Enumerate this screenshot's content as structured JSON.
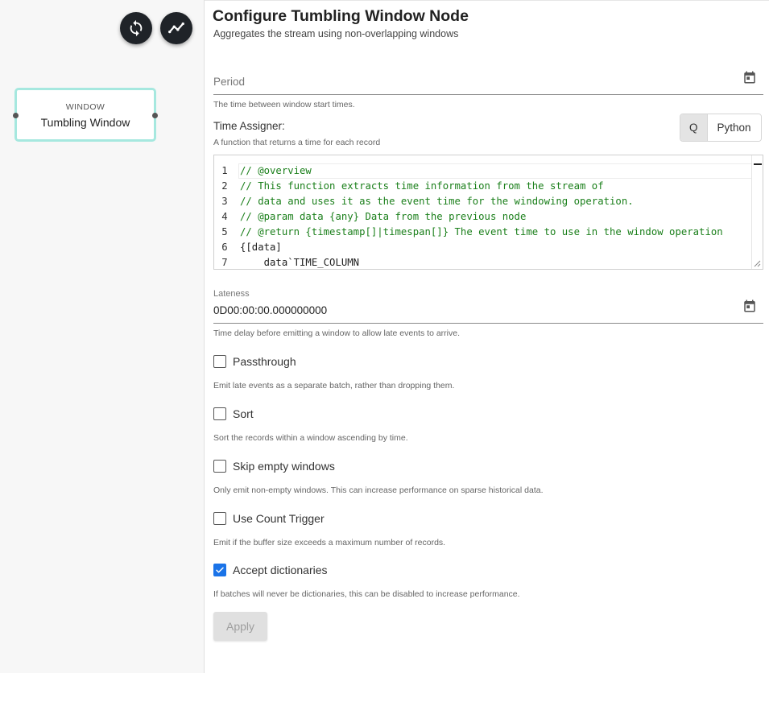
{
  "canvas": {
    "node": {
      "type": "WINDOW",
      "name": "Tumbling Window"
    }
  },
  "form": {
    "title": "Configure Tumbling Window Node",
    "subtitle": "Aggregates the stream using non-overlapping windows",
    "period": {
      "label": "Period",
      "value": "",
      "helper": "The time between window start times."
    },
    "time_assigner": {
      "label": "Time Assigner:",
      "helper": "A function that returns a time for each record",
      "languages": [
        "Q",
        "Python"
      ],
      "selected_language": "Q",
      "code_lines": [
        {
          "n": "1",
          "text": "// @overview",
          "kind": "cm"
        },
        {
          "n": "2",
          "text": "// This function extracts time information from the stream of",
          "kind": "cm"
        },
        {
          "n": "3",
          "text": "// data and uses it as the event time for the windowing operation.",
          "kind": "cm"
        },
        {
          "n": "4",
          "text": "// @param data {any} Data from the previous node",
          "kind": "cm"
        },
        {
          "n": "5",
          "text": "// @return {timestamp[]|timespan[]} The event time to use in the window operation",
          "kind": "cm"
        },
        {
          "n": "6",
          "text": "{[data]",
          "kind": "plain"
        },
        {
          "n": "7",
          "text": "    data`TIME_COLUMN",
          "kind": "mixed",
          "pre": "    data`",
          "post": "TIME_COLUMN"
        }
      ]
    },
    "lateness": {
      "label": "Lateness",
      "value": "0D00:00:00.000000000",
      "helper": "Time delay before emitting a window to allow late events to arrive."
    },
    "options": [
      {
        "id": "passthrough",
        "label": "Passthrough",
        "checked": false,
        "helper": "Emit late events as a separate batch, rather than dropping them."
      },
      {
        "id": "sort",
        "label": "Sort",
        "checked": false,
        "helper": "Sort the records within a window ascending by time."
      },
      {
        "id": "skip-empty-windows",
        "label": "Skip empty windows",
        "checked": false,
        "helper": "Only emit non-empty windows. This can increase performance on sparse historical data."
      },
      {
        "id": "use-count-trigger",
        "label": "Use Count Trigger",
        "checked": false,
        "helper": "Emit if the buffer size exceeds a maximum number of records."
      },
      {
        "id": "accept-dictionaries",
        "label": "Accept dictionaries",
        "checked": true,
        "helper": "If batches will never be dictionaries, this can be disabled to increase performance."
      }
    ],
    "apply_label": "Apply"
  },
  "colors": {
    "node_border": "#a6e8df",
    "check_accent": "#1a73e8",
    "fab_bg": "#1f2328",
    "comment_green": "#1a7f1a"
  }
}
